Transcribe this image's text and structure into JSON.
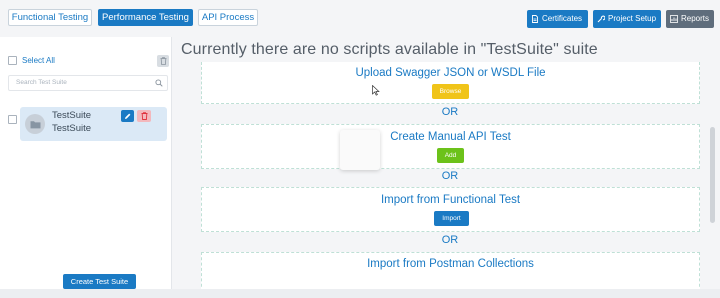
{
  "tabs": [
    {
      "label": "Functional Testing",
      "active": false
    },
    {
      "label": "Performance Testing",
      "active": true
    },
    {
      "label": "API Process",
      "active": false
    }
  ],
  "toolbar": {
    "certificates": "Certificates",
    "project_setup": "Project Setup",
    "reports": "Reports"
  },
  "sidebar": {
    "select_all": "Select All",
    "search_placeholder": "Search Test Suite",
    "suite": {
      "line1": "TestSuite",
      "line2": "TestSuite"
    },
    "create_button": "Create Test Suite"
  },
  "main": {
    "title": "Currently there are no scripts available in \"TestSuite\" suite",
    "options": [
      {
        "title": "Upload Swagger JSON or WSDL File",
        "button": "Browse"
      },
      {
        "title": "Create Manual API Test",
        "button": "Add"
      },
      {
        "title": "Import from Functional Test",
        "button": "Import"
      },
      {
        "title": "Import from Postman Collections"
      }
    ],
    "or_label": "OR"
  },
  "colors": {
    "accent": "#1a7ac4",
    "browse": "#f0c419",
    "add": "#6cc21a",
    "delete": "#f3b8bd",
    "reports": "#5f6d7c"
  }
}
